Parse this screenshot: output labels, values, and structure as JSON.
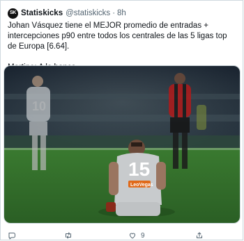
{
  "tweet": {
    "author": {
      "avatar_text": "SK",
      "name": "Statiskicks",
      "handle": "@statiskicks",
      "separator": "·",
      "time": "8h"
    },
    "text_line1": "Johan Vásquez tiene el MEJOR promedio de entradas + intercepciones p90 entre todos los centrales de las 5 ligas top de Europa [6.64].",
    "text_line2": "Martino: A la banca.",
    "media": {
      "jersey_number_foreground": "15",
      "jersey_number_background": "10",
      "jersey_sponsor": "LeoVegas"
    },
    "actions": {
      "reply_icon": "reply-icon",
      "retweet_icon": "retweet-icon",
      "like_icon": "heart-icon",
      "like_count": "9",
      "share_icon": "share-icon"
    }
  },
  "colors": {
    "text": "#0f1419",
    "secondary": "#536471",
    "border": "#cfd9de",
    "pitch": "#2f6a2a"
  }
}
